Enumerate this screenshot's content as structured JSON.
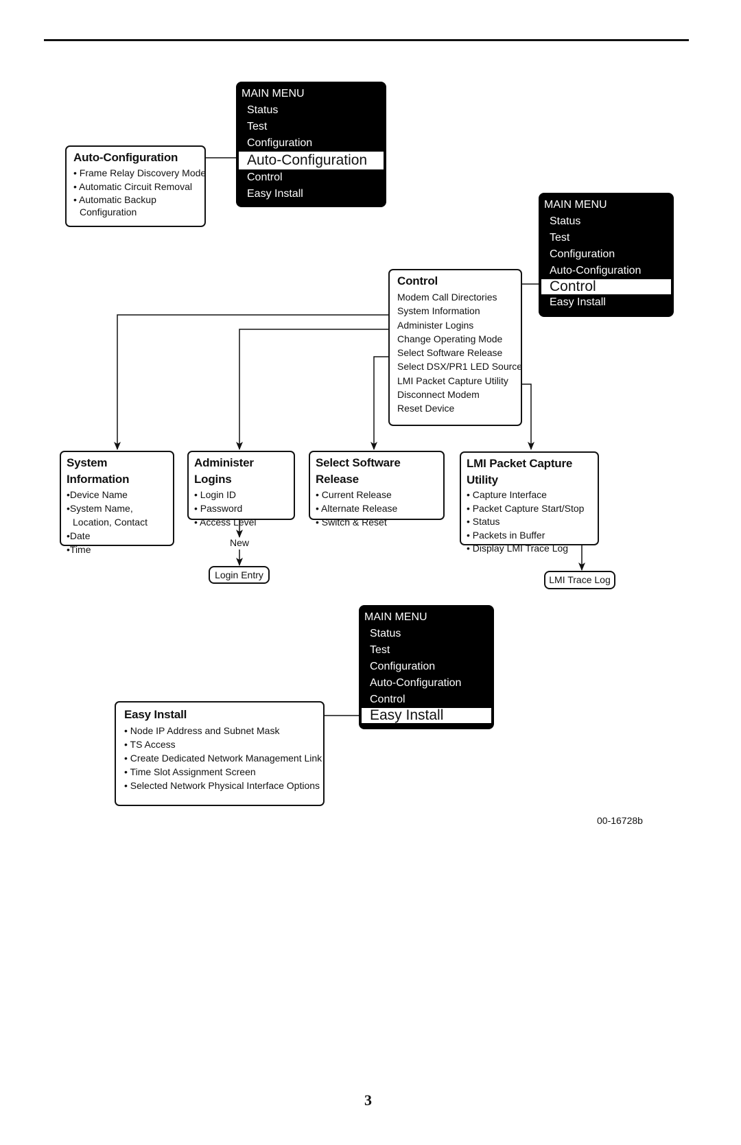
{
  "menus": [
    {
      "title": "MAIN MENU",
      "items": [
        "Status",
        "Test",
        "Configuration",
        "Auto-Configuration",
        "Control",
        "Easy Install"
      ],
      "selected": "Auto-Configuration"
    },
    {
      "title": "MAIN MENU",
      "items": [
        "Status",
        "Test",
        "Configuration",
        "Auto-Configuration",
        "Control",
        "Easy Install"
      ],
      "selected": "Control"
    },
    {
      "title": "MAIN MENU",
      "items": [
        "Status",
        "Test",
        "Configuration",
        "Auto-Configuration",
        "Control",
        "Easy Install"
      ],
      "selected": "Easy Install"
    }
  ],
  "auto_configuration": {
    "title": "Auto-Configuration",
    "items": [
      "Frame Relay Discovery Mode",
      "Automatic Circuit Removal",
      "Automatic Backup",
      "Configuration"
    ]
  },
  "control": {
    "title": "Control",
    "items": [
      "Modem Call Directories",
      "System Information",
      "Administer Logins",
      "Change Operating Mode",
      "Select Software Release",
      "Select DSX/PR1 LED Source",
      "LMI Packet Capture Utility",
      "Disconnect Modem",
      "Reset Device"
    ]
  },
  "system_information": {
    "title": "System Information",
    "items": [
      "Device Name",
      "System Name,",
      "Location, Contact",
      "Date",
      "Time"
    ]
  },
  "administer_logins": {
    "title": "Administer Logins",
    "items": [
      "Login ID",
      "Password",
      "Access Level"
    ],
    "edge_label": "New",
    "child": "Login Entry"
  },
  "select_software_release": {
    "title": "Select Software Release",
    "items": [
      "Current Release",
      "Alternate Release",
      "Switch & Reset"
    ]
  },
  "lmi_packet_capture": {
    "title": "LMI Packet Capture Utility",
    "items": [
      "Capture Interface",
      "Packet Capture Start/Stop",
      "Status",
      "Packets in Buffer",
      "Display LMI Trace Log"
    ],
    "child": "LMI Trace Log"
  },
  "easy_install": {
    "title": "Easy Install",
    "items": [
      "Node IP Address and Subnet Mask",
      "TS Access",
      "Create Dedicated Network Management Link",
      "Time Slot Assignment Screen",
      "Selected Network Physical Interface Options"
    ]
  },
  "bullet": "•",
  "figure_id": "00-16728b",
  "page_number": "3"
}
